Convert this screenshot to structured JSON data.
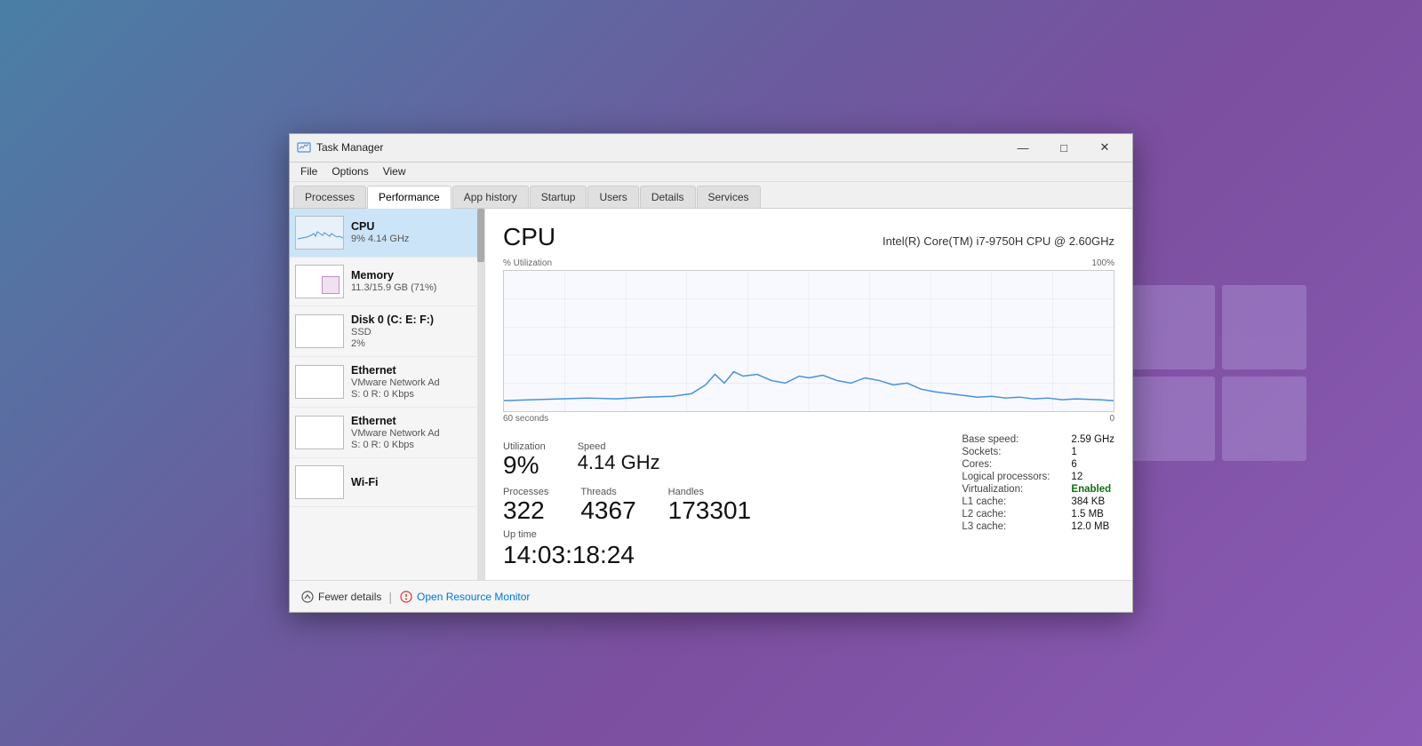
{
  "window": {
    "title": "Task Manager",
    "controls": {
      "minimize": "—",
      "maximize": "□",
      "close": "✕"
    }
  },
  "menu": {
    "items": [
      "File",
      "Options",
      "View"
    ]
  },
  "tabs": {
    "items": [
      "Processes",
      "Performance",
      "App history",
      "Startup",
      "Users",
      "Details",
      "Services"
    ],
    "active": "Performance"
  },
  "left_panel": {
    "devices": [
      {
        "name": "CPU",
        "sub": "9%  4.14 GHz",
        "type": "cpu",
        "selected": true
      },
      {
        "name": "Memory",
        "sub": "11.3/15.9 GB (71%)",
        "type": "memory",
        "selected": false
      },
      {
        "name": "Disk 0 (C: E: F:)",
        "sub": "SSD",
        "val": "2%",
        "type": "disk",
        "selected": false
      },
      {
        "name": "Ethernet",
        "sub": "VMware Network Ad",
        "val": "S: 0 R: 0 Kbps",
        "type": "ethernet1",
        "selected": false
      },
      {
        "name": "Ethernet",
        "sub": "VMware Network Ad",
        "val": "S: 0 R: 0 Kbps",
        "type": "ethernet2",
        "selected": false
      },
      {
        "name": "Wi-Fi",
        "sub": "",
        "val": "",
        "type": "wifi",
        "selected": false
      }
    ]
  },
  "cpu_panel": {
    "title": "CPU",
    "model": "Intel(R) Core(TM) i7-9750H CPU @ 2.60GHz",
    "chart": {
      "y_label": "% Utilization",
      "y_max": "100%",
      "x_label": "60 seconds",
      "x_end": "0"
    },
    "stats": {
      "utilization_label": "Utilization",
      "utilization_value": "9%",
      "speed_label": "Speed",
      "speed_value": "4.14 GHz",
      "processes_label": "Processes",
      "processes_value": "322",
      "threads_label": "Threads",
      "threads_value": "4367",
      "handles_label": "Handles",
      "handles_value": "173301",
      "uptime_label": "Up time",
      "uptime_value": "14:03:18:24"
    },
    "info": {
      "base_speed_label": "Base speed:",
      "base_speed_value": "2.59 GHz",
      "sockets_label": "Sockets:",
      "sockets_value": "1",
      "cores_label": "Cores:",
      "cores_value": "6",
      "logical_proc_label": "Logical processors:",
      "logical_proc_value": "12",
      "virtualization_label": "Virtualization:",
      "virtualization_value": "Enabled",
      "l1_cache_label": "L1 cache:",
      "l1_cache_value": "384 KB",
      "l2_cache_label": "L2 cache:",
      "l2_cache_value": "1.5 MB",
      "l3_cache_label": "L3 cache:",
      "l3_cache_value": "12.0 MB"
    }
  },
  "footer": {
    "fewer_details": "Fewer details",
    "open_resource_monitor": "Open Resource Monitor"
  }
}
